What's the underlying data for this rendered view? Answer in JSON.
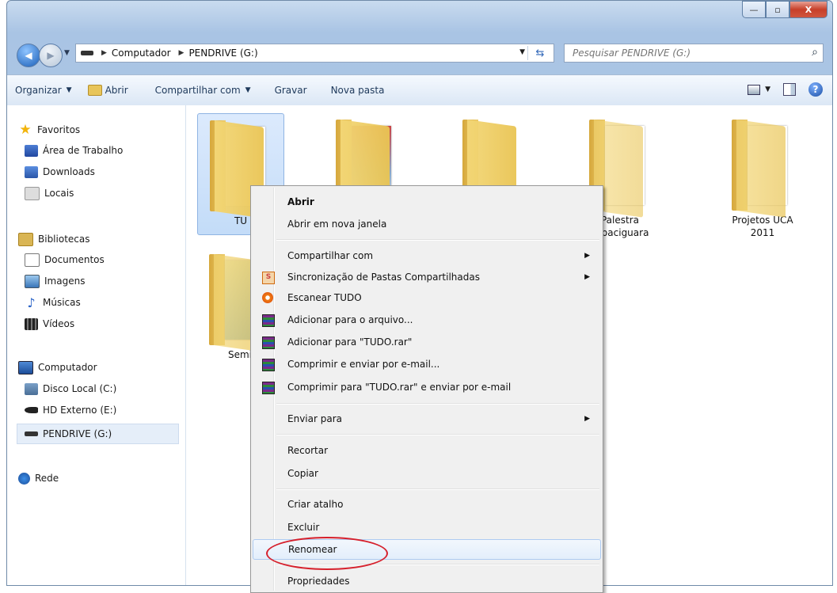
{
  "window": {
    "buttons": {
      "minimize": "—",
      "maximize": "▫",
      "close": "X"
    }
  },
  "address_bar": {
    "breadcrumbs": [
      "Computador",
      "PENDRIVE (G:)"
    ],
    "search_placeholder": "Pesquisar PENDRIVE (G:)"
  },
  "toolbar": {
    "organize": "Organizar",
    "open": "Abrir",
    "share": "Compartilhar com",
    "burn": "Gravar",
    "new_folder": "Nova pasta"
  },
  "sidebar": {
    "favorites": {
      "label": "Favoritos",
      "items": [
        "Área de Trabalho",
        "Downloads",
        "Locais"
      ]
    },
    "libraries": {
      "label": "Bibliotecas",
      "items": [
        "Documentos",
        "Imagens",
        "Músicas",
        "Vídeos"
      ]
    },
    "computer": {
      "label": "Computador",
      "items": [
        "Disco Local (C:)",
        "HD Externo (E:)",
        "PENDRIVE (G:)"
      ]
    },
    "network": {
      "label": "Rede"
    }
  },
  "files": [
    {
      "label": "TU"
    },
    {
      "label": ""
    },
    {
      "label": ""
    },
    {
      "label": "Palestra Tupaciguara"
    },
    {
      "label": "Projetos UCA 2011"
    },
    {
      "label": "Semi"
    }
  ],
  "context_menu": {
    "open": "Abrir",
    "open_new_window": "Abrir em nova janela",
    "share_with": "Compartilhar com",
    "sync_shared": "Sincronização de Pastas Compartilhadas",
    "scan": "Escanear TUDO",
    "add_archive": "Adicionar para o arquivo...",
    "add_rar": "Adicionar para \"TUDO.rar\"",
    "compress_email": "Comprimir e enviar por e-mail...",
    "compress_rar_email": "Comprimir para \"TUDO.rar\" e enviar por e-mail",
    "send_to": "Enviar para",
    "cut": "Recortar",
    "copy": "Copiar",
    "create_shortcut": "Criar atalho",
    "delete": "Excluir",
    "rename": "Renomear",
    "properties": "Propriedades"
  },
  "colors": {
    "highlight_circle": "#d6202c",
    "selection": "#c3dcf8"
  }
}
